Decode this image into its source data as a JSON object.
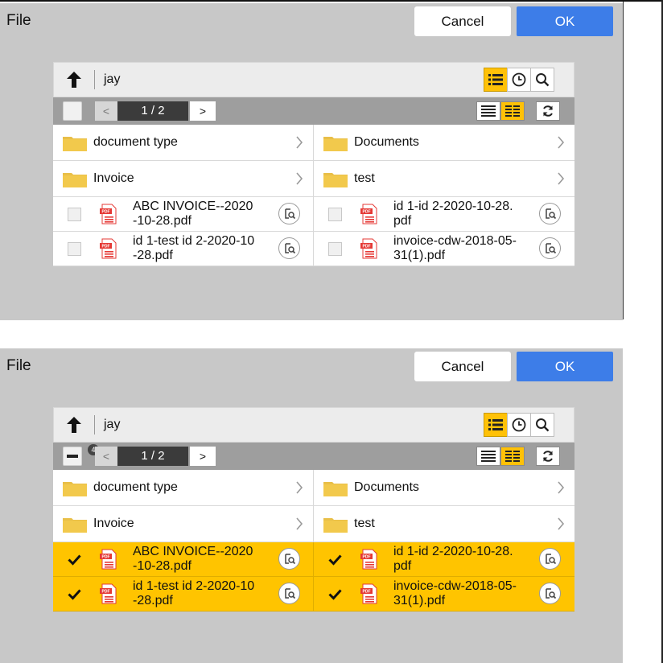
{
  "panels": [
    {
      "header": {
        "title": "File",
        "cancel_label": "Cancel",
        "ok_label": "OK"
      },
      "toolbar": {
        "folder": "jay",
        "icons": [
          "up-arrow-icon",
          "list-view-icon",
          "recent-clock-icon",
          "search-icon"
        ],
        "active_view": "list"
      },
      "pager": {
        "page": "1 / 2",
        "prev": "<",
        "next": ">",
        "select_all_checked": false,
        "selected_count": null
      },
      "folders": [
        "document type",
        "Documents",
        "Invoice",
        "test"
      ],
      "files": [
        {
          "line1": "ABC INVOICE--2020",
          "line2": "-10-28.pdf",
          "selected": false
        },
        {
          "line1": "id 1-id 2-2020-10-28.",
          "line2": "pdf",
          "selected": false
        },
        {
          "line1": "id 1-test id 2-2020-10",
          "line2": "-28.pdf",
          "selected": false
        },
        {
          "line1": "invoice-cdw-2018-05-",
          "line2": "31(1).pdf",
          "selected": false
        }
      ]
    },
    {
      "header": {
        "title": "File",
        "cancel_label": "Cancel",
        "ok_label": "OK"
      },
      "toolbar": {
        "folder": "jay",
        "icons": [
          "up-arrow-icon",
          "list-view-icon",
          "recent-clock-icon",
          "search-icon"
        ],
        "active_view": "list"
      },
      "pager": {
        "page": "1 / 2",
        "prev": "<",
        "next": ">",
        "select_all_checked": true,
        "selected_count": "4"
      },
      "folders": [
        "document type",
        "Documents",
        "Invoice",
        "test"
      ],
      "files": [
        {
          "line1": "ABC INVOICE--2020",
          "line2": "-10-28.pdf",
          "selected": true
        },
        {
          "line1": "id 1-id 2-2020-10-28.",
          "line2": "pdf",
          "selected": true
        },
        {
          "line1": "id 1-test id 2-2020-10",
          "line2": "-28.pdf",
          "selected": true
        },
        {
          "line1": "invoice-cdw-2018-05-",
          "line2": "31(1).pdf",
          "selected": true
        }
      ]
    }
  ],
  "colors": {
    "accent": "#ffc107",
    "ok_button": "#3d7de8",
    "selection": "#ffc400",
    "panel_bg": "#c8c8c8",
    "pdf_red": "#e53935"
  }
}
